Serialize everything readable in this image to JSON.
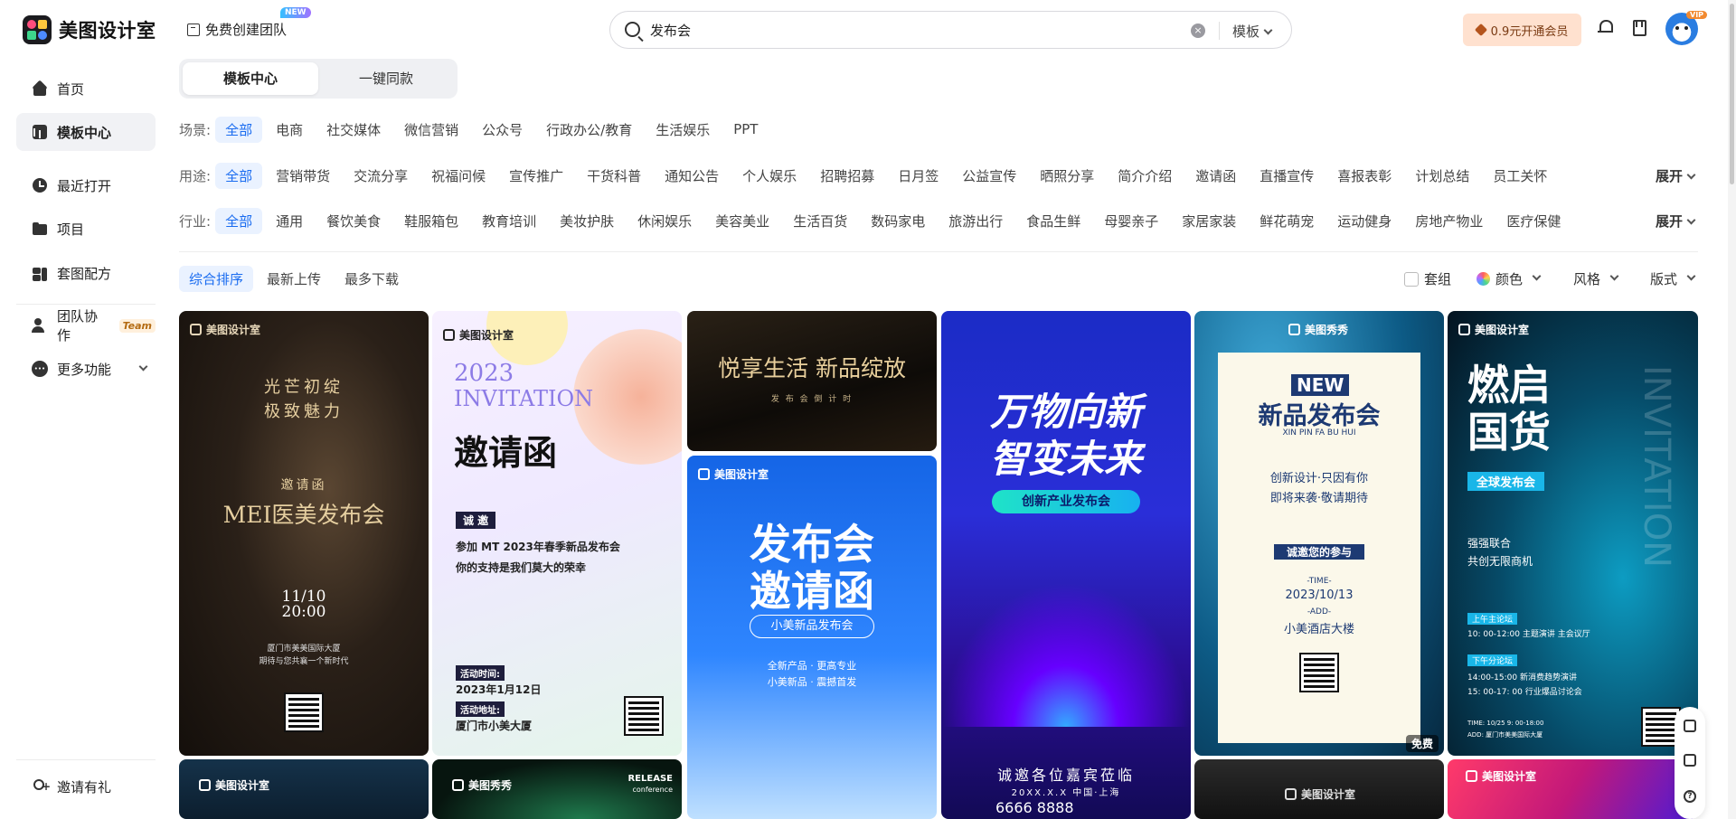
{
  "header": {
    "logo_text": "美图设计室",
    "create_team": "免费创建团队",
    "new_badge": "NEW",
    "search_value": "发布会",
    "search_type": "模板",
    "vip_button": "0.9元开通会员",
    "vip_tag": "VIP"
  },
  "sidebar": {
    "items": [
      {
        "label": "首页",
        "icon": "home-icon"
      },
      {
        "label": "模板中心",
        "icon": "template-icon"
      },
      {
        "label": "最近打开",
        "icon": "clock-icon"
      },
      {
        "label": "项目",
        "icon": "folder-icon"
      },
      {
        "label": "套图配方",
        "icon": "combo-icon"
      },
      {
        "label": "团队协作",
        "icon": "team-icon",
        "tag": "Team"
      },
      {
        "label": "更多功能",
        "icon": "more-icon"
      }
    ],
    "invite": "邀请有礼"
  },
  "tabs": {
    "template_center": "模板中心",
    "one_click": "一键同款"
  },
  "filters": {
    "scene": {
      "label": "场景:",
      "options": [
        "全部",
        "电商",
        "社交媒体",
        "微信营销",
        "公众号",
        "行政办公/教育",
        "生活娱乐",
        "PPT"
      ]
    },
    "usage": {
      "label": "用途:",
      "options": [
        "全部",
        "营销带货",
        "交流分享",
        "祝福问候",
        "宣传推广",
        "干货科普",
        "通知公告",
        "个人娱乐",
        "招聘招募",
        "日月签",
        "公益宣传",
        "晒照分享",
        "简介介绍",
        "邀请函",
        "直播宣传",
        "喜报表彰",
        "计划总结",
        "员工关怀"
      ]
    },
    "industry": {
      "label": "行业:",
      "options": [
        "全部",
        "通用",
        "餐饮美食",
        "鞋服箱包",
        "教育培训",
        "美妆护肤",
        "休闲娱乐",
        "美容美业",
        "生活百货",
        "数码家电",
        "旅游出行",
        "食品生鲜",
        "母婴亲子",
        "家居家装",
        "鲜花萌宠",
        "运动健身",
        "房地产物业",
        "医疗保健"
      ]
    },
    "expand": "展开"
  },
  "sort": {
    "options": [
      "综合排序",
      "最新上传",
      "最多下载"
    ],
    "set": "套组",
    "color": "颜色",
    "style": "风格",
    "format": "版式"
  },
  "cards": {
    "c1": {
      "brand": "美图设计室",
      "line1": "光芒初绽",
      "line2": "极致魅力",
      "sub": "邀请函",
      "title": "MEI医美发布会",
      "date": "11/10",
      "time": "20:00",
      "addr1": "厦门市美美国际大厦",
      "addr2": "期待与您共襄一个新时代"
    },
    "c2": {
      "brand": "美图设计室",
      "year": "2023",
      "inv": "INVITATION",
      "title": "邀请函",
      "tag": "诚 邀",
      "text1": "参加 MT 2023年春季新品发布会",
      "text2": "你的支持是我们莫大的荣幸",
      "time_label": "活动时间:",
      "time": "2023年1月12日",
      "place_label": "活动地址:",
      "place": "厦门市小美大厦"
    },
    "c3": {
      "title": "悦享生活  新品绽放",
      "sub": "发 布 会 倒 计 时"
    },
    "c4": {
      "brand": "美图设计室",
      "title1": "发布会",
      "title2": "邀请函",
      "pill": "小美新品发布会",
      "t1": "全新产品 · 更高专业",
      "t2": "小美新品 · 震撼首发"
    },
    "c5": {
      "title1": "万物向新",
      "title2": "智变未来",
      "pill": "创新产业发布会",
      "invite": "诚邀各位嘉宾莅临",
      "date": "20XX.X.X 中国·上海",
      "phone": "6666 8888"
    },
    "c6": {
      "brand": "美图秀秀",
      "new": "NEW",
      "title": "新品发布会",
      "pinyin": "XIN PIN FA BU HUI",
      "l1": "创新设计·只因有你",
      "l2": "即将来袭·敬请期待",
      "invite": "诚邀您的参与",
      "time_label": "-TIME-",
      "time": "2023/10/13",
      "add_label": "-ADD-",
      "add": "小美酒店大楼",
      "free": "免费"
    },
    "c7": {
      "brand": "美图设计室",
      "title1": "燃启",
      "title2": "国货",
      "pill": "全球发布会",
      "side": "INVITATION",
      "l1": "强强联合",
      "l2": "共创无限商机",
      "am": "上午主论坛",
      "am1": "10: 00-12:00 主题演讲 主会议厅",
      "pm": "下午分论坛",
      "pm1": "14:00-15:00  新消费趋势演讲",
      "pm2": "15: 00-17: 00  行业爆品讨论会",
      "foot1": "TIME: 10/25  9: 00-18:00",
      "foot2": "ADD: 厦门市美美国际大厦"
    },
    "c8": {
      "brand": "美图设计室"
    },
    "c9": {
      "brand": "美图秀秀",
      "tag1": "RELEASE",
      "tag2": "conference"
    },
    "c10": {
      "brand": "美图设计室"
    },
    "c11": {
      "brand": "美图设计室"
    }
  },
  "colors": {
    "accent": "#1a6cf0",
    "selected_chip_bg": "#eaf2ff",
    "vip_bg": "#ffe1cf"
  }
}
